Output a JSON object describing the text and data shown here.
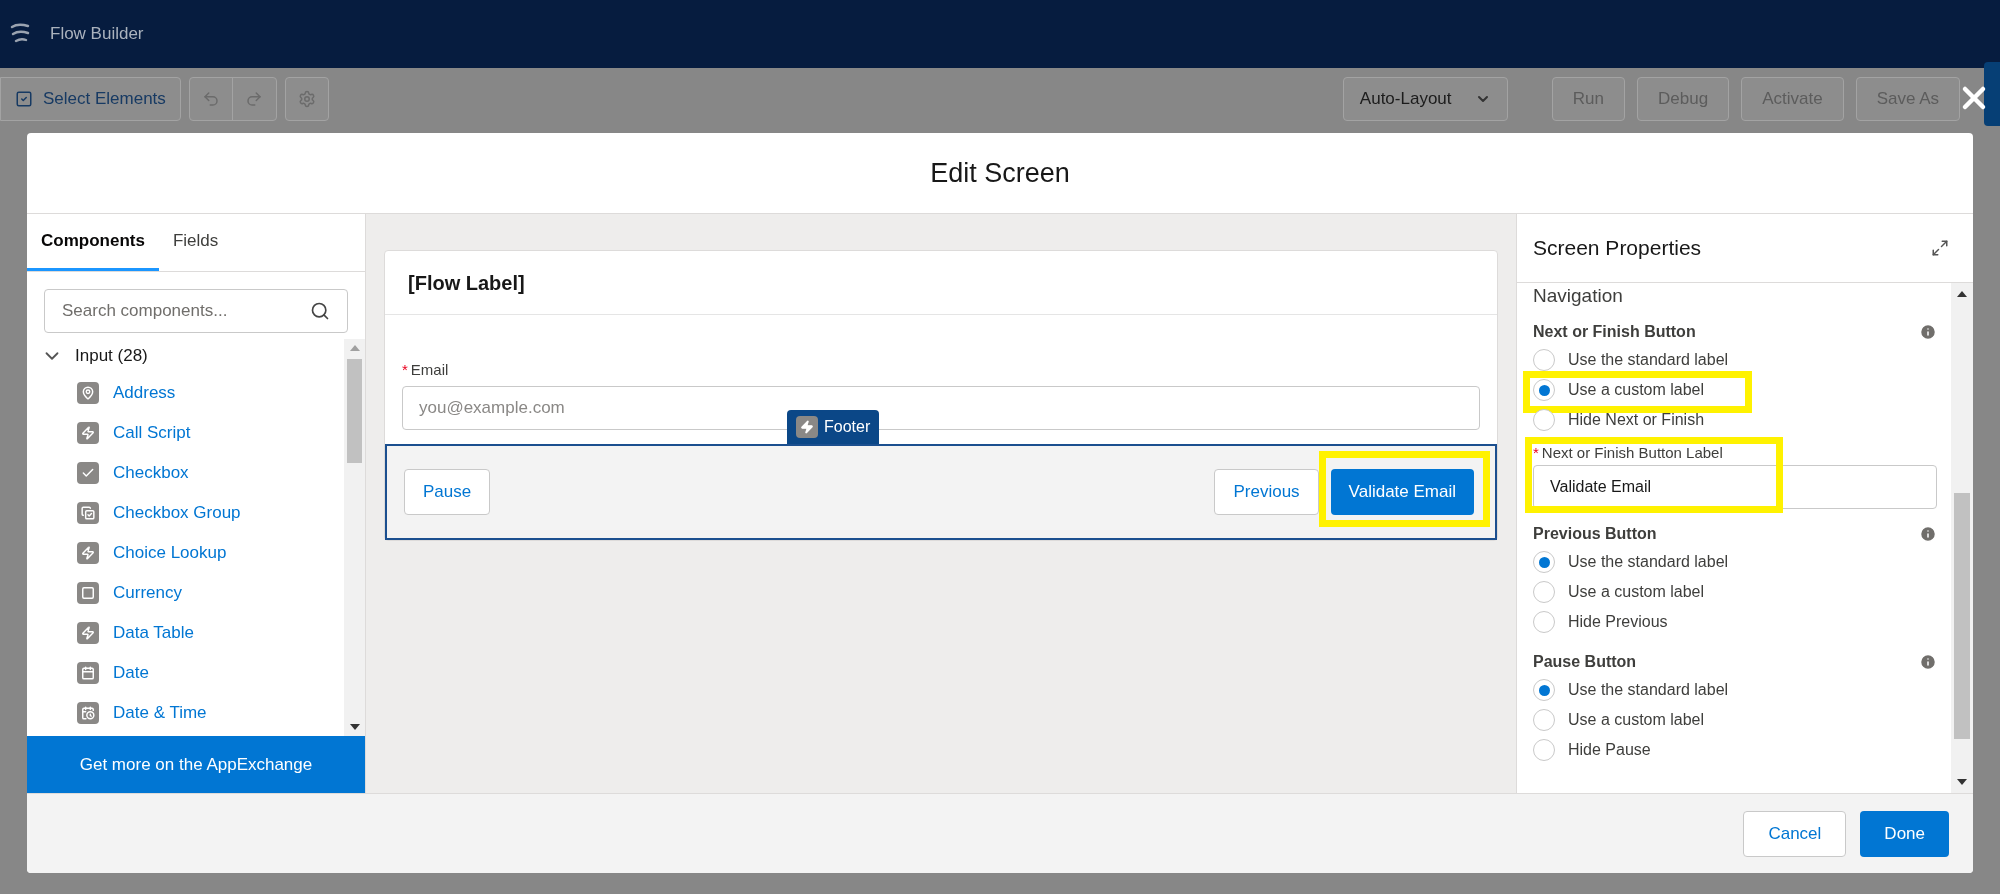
{
  "app_bar": {
    "title": "Flow Builder"
  },
  "toolbar": {
    "select_button": "Select Elements",
    "layout_menu": "Auto-Layout",
    "actions": [
      {
        "label": "Run",
        "disabled": true
      },
      {
        "label": "Debug",
        "disabled": true
      },
      {
        "label": "Activate",
        "disabled": true
      },
      {
        "label": "Save As",
        "disabled": true
      }
    ]
  },
  "modal": {
    "title": "Edit Screen",
    "left_panel": {
      "tabs": [
        {
          "label": "Components",
          "selected": true
        },
        {
          "label": "Fields",
          "selected": false
        }
      ],
      "search": {
        "placeholder": "Search components..."
      },
      "group": {
        "label": "Input (28)",
        "expanded": true,
        "children": [
          {
            "label": "Address",
            "kind": "pin"
          },
          {
            "label": "Call Script",
            "kind": "bolt"
          },
          {
            "label": "Checkbox",
            "kind": "check"
          },
          {
            "label": "Checkbox Group",
            "kind": "checkgroup"
          },
          {
            "label": "Choice Lookup",
            "kind": "bolt"
          },
          {
            "label": "Currency",
            "kind": "frame"
          },
          {
            "label": "Data Table",
            "kind": "bolt"
          },
          {
            "label": "Date",
            "kind": "calendar"
          },
          {
            "label": "Date & Time",
            "kind": "calendarclock"
          }
        ]
      },
      "appexchange_button": "Get more on the AppExchange"
    },
    "canvas": {
      "card_title": "[Flow Label]",
      "field": {
        "label": "Email",
        "required_mark": "*",
        "placeholder": "you@example.com"
      },
      "footer": {
        "badge": "Footer",
        "left_buttons": [
          {
            "label": "Pause",
            "kind": "neutral"
          }
        ],
        "right_buttons": [
          {
            "label": "Previous",
            "kind": "neutral"
          },
          {
            "label": "Validate Email",
            "kind": "brand",
            "highlighted": true
          }
        ]
      }
    },
    "properties": {
      "title": "Screen Properties",
      "section": "Navigation",
      "groups": [
        {
          "title": "Next or Finish Button",
          "options": [
            {
              "label": "Use the standard label",
              "selected": false
            },
            {
              "label": "Use a custom label",
              "selected": true,
              "highlighted": true
            },
            {
              "label": "Hide Next or Finish",
              "selected": false
            }
          ],
          "custom_field": {
            "label": "Next or Finish Button Label",
            "required_mark": "*",
            "value": "Validate Email",
            "highlighted": true
          }
        },
        {
          "title": "Previous Button",
          "options": [
            {
              "label": "Use the standard label",
              "selected": true
            },
            {
              "label": "Use a custom label",
              "selected": false
            },
            {
              "label": "Hide Previous",
              "selected": false
            }
          ]
        },
        {
          "title": "Pause Button",
          "options": [
            {
              "label": "Use the standard label",
              "selected": true
            },
            {
              "label": "Use a custom label",
              "selected": false
            },
            {
              "label": "Hide Pause",
              "selected": false
            }
          ]
        }
      ]
    },
    "footer_buttons": [
      {
        "label": "Cancel",
        "kind": "neutral"
      },
      {
        "label": "Done",
        "kind": "brand"
      }
    ]
  }
}
